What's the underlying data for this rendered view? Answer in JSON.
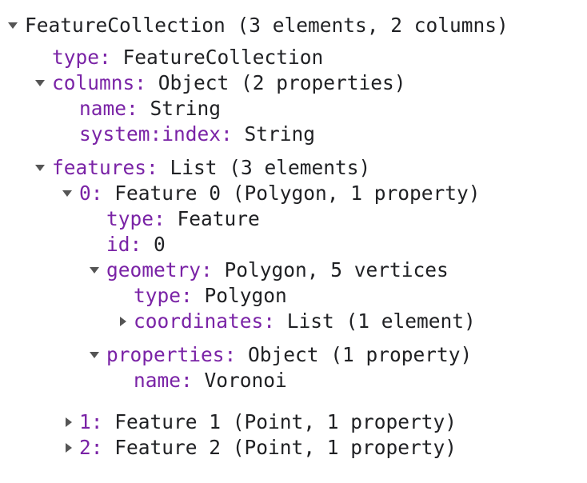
{
  "root": {
    "label": "FeatureCollection (3 elements, 2 columns)",
    "type": {
      "key": "type:",
      "value": "FeatureCollection"
    },
    "columns": {
      "key": "columns:",
      "value": "Object (2 properties)",
      "items": [
        {
          "key": "name:",
          "value": "String"
        },
        {
          "key": "system:index:",
          "value": "String"
        }
      ]
    },
    "features": {
      "key": "features:",
      "value": "List (3 elements)",
      "items": [
        {
          "key": "0:",
          "value": "Feature 0 (Polygon, 1 property)",
          "type": {
            "key": "type:",
            "value": "Feature"
          },
          "id": {
            "key": "id:",
            "value": "0"
          },
          "geometry": {
            "key": "geometry:",
            "value": "Polygon, 5 vertices",
            "type": {
              "key": "type:",
              "value": "Polygon"
            },
            "coordinates": {
              "key": "coordinates:",
              "value": "List (1 element)"
            }
          },
          "properties": {
            "key": "properties:",
            "value": "Object (1 property)",
            "name": {
              "key": "name:",
              "value": "Voronoi"
            }
          }
        },
        {
          "key": "1:",
          "value": "Feature 1 (Point, 1 property)"
        },
        {
          "key": "2:",
          "value": "Feature 2 (Point, 1 property)"
        }
      ]
    }
  }
}
